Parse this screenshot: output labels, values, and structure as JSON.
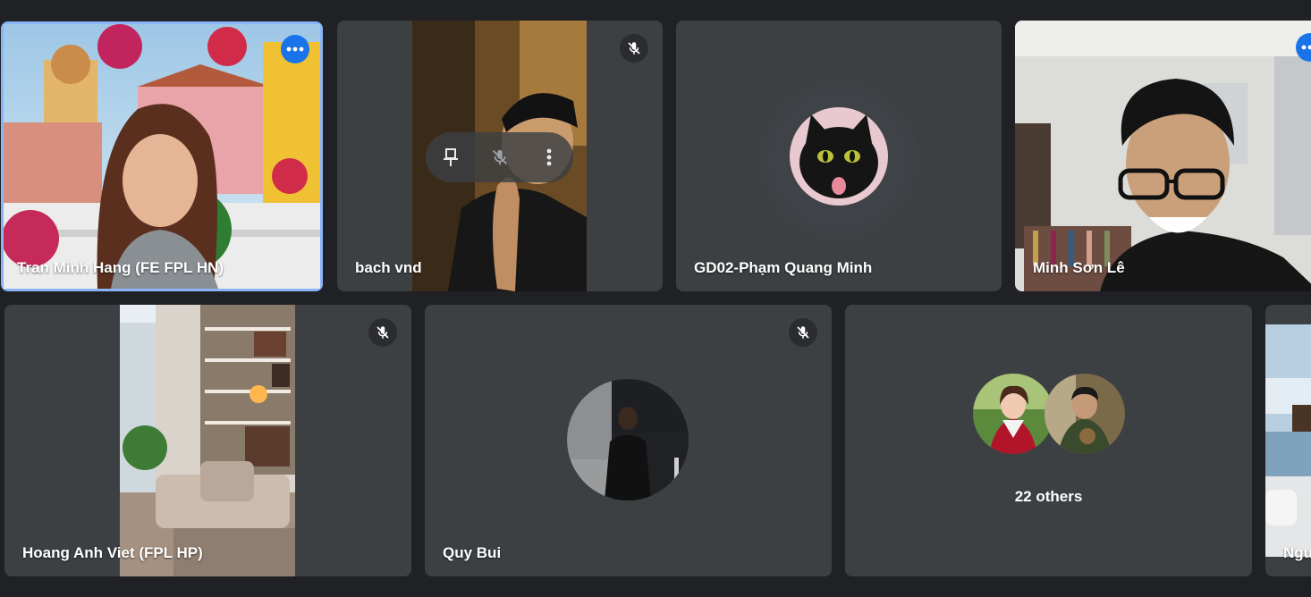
{
  "participants": [
    {
      "name": "Tran Minh Hang (FE FPL HN)"
    },
    {
      "name": "bach vnd"
    },
    {
      "name": "GD02-Phạm Quang Minh"
    },
    {
      "name": "Minh Sơn Lê"
    },
    {
      "name": "Hoang Anh Viet (FPL HP)"
    },
    {
      "name": "Quy Bui"
    },
    {
      "name": "Ngu"
    }
  ],
  "others": {
    "label": "22 others"
  },
  "colors": {
    "background": "#202124",
    "tile": "#3c4043",
    "active_border": "#8ab4f8",
    "accent": "#1a73e8"
  },
  "icons": [
    "more-options-icon",
    "mic-off-icon",
    "pin-icon",
    "more-vert-icon"
  ]
}
